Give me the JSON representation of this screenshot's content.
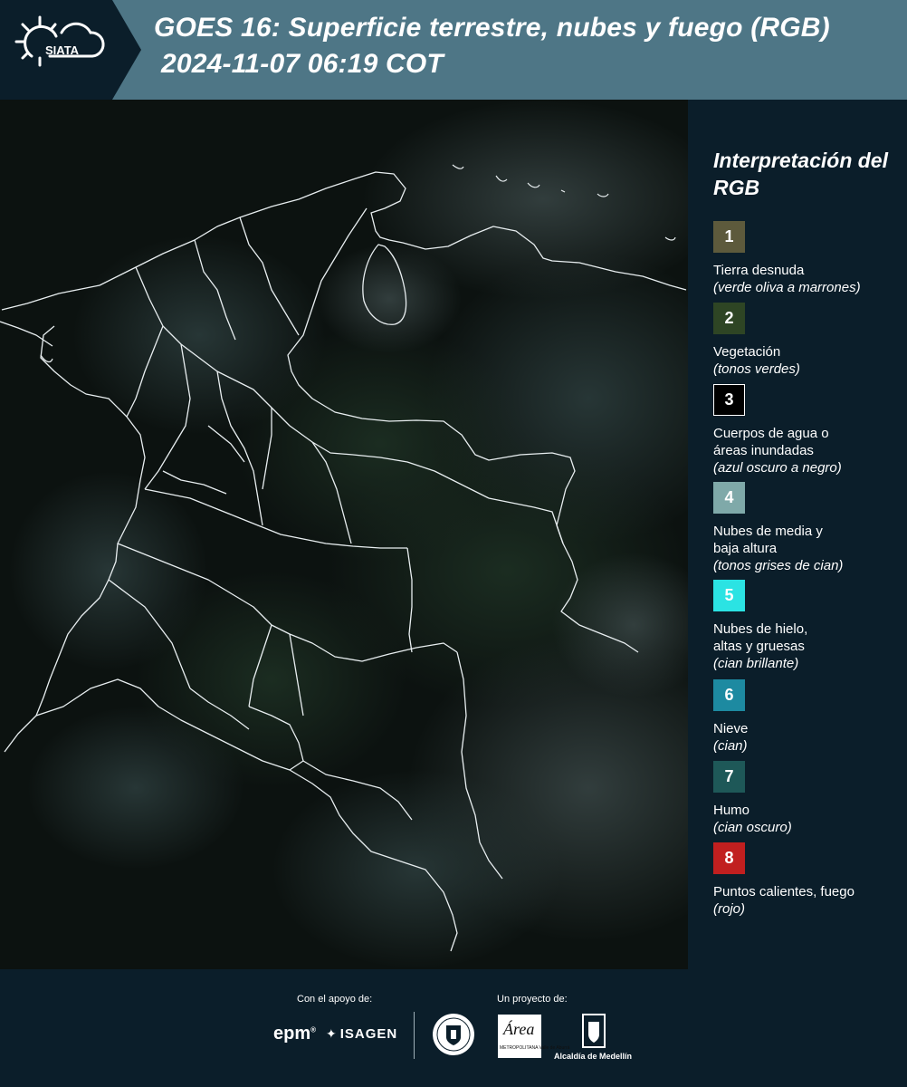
{
  "header": {
    "logo_text": "SIATA",
    "title_line1": "GOES 16: Superficie terrestre, nubes y fuego (RGB)",
    "title_line2": "2024-11-07 06:19 COT",
    "background_color": "#4e7686",
    "logo_background_color": "#0b1e2a"
  },
  "legend": {
    "title": "Interpretación del RGB",
    "items": [
      {
        "number": "1",
        "label": "Tierra desnuda",
        "sub": "(verde oliva a marrones)",
        "color": "#5d5a3c"
      },
      {
        "number": "2",
        "label": "Vegetación",
        "sub": "(tonos verdes)",
        "color": "#2e4524"
      },
      {
        "number": "3",
        "label": "Cuerpos de agua o áreas inundadas",
        "sub": "(azul oscuro a negro)",
        "color": "#000000"
      },
      {
        "number": "4",
        "label": "Nubes de media y baja altura",
        "sub": "(tonos grises de cian)",
        "color": "#7fa9a9"
      },
      {
        "number": "5",
        "label": "Nubes de hielo, altas y gruesas",
        "sub": "(cian brillante)",
        "color": "#2be3e3"
      },
      {
        "number": "6",
        "label": "Nieve",
        "sub": "(cian)",
        "color": "#1d8aa1"
      },
      {
        "number": "7",
        "label": "Humo",
        "sub": "(cian oscuro)",
        "color": "#1e5858"
      },
      {
        "number": "8",
        "label": "Puntos calientes, fuego",
        "sub": "(rojo)",
        "color": "#c11f1f"
      }
    ]
  },
  "footer": {
    "support_heading": "Con el apoyo de:",
    "project_heading": "Un proyecto de:",
    "epm": "epm",
    "isagen": "ISAGEN",
    "area_word": "Área",
    "area_sub": "METROPOLITANA Valle de Aburrá",
    "medellin": "Alcaldía de Medellín"
  }
}
